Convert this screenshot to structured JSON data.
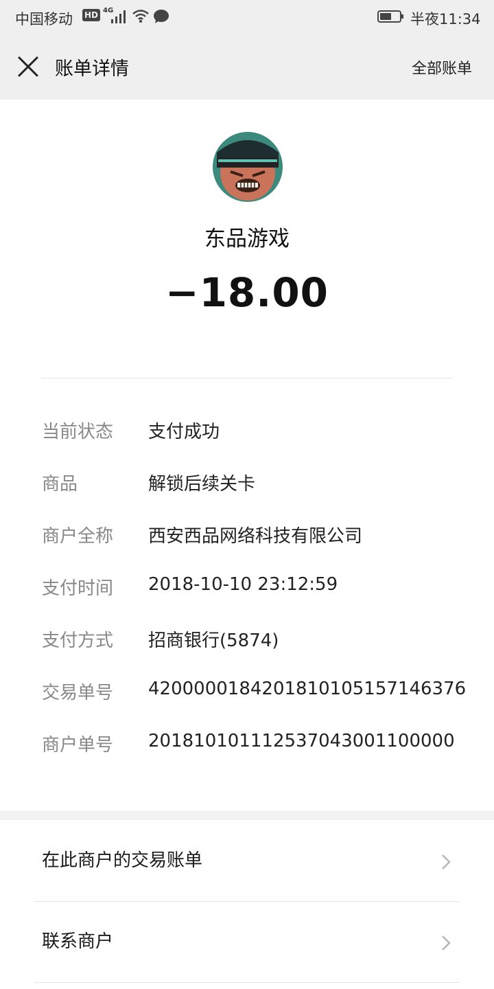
{
  "status_bar": {
    "carrier": "中国移动",
    "hd_badge": "HD",
    "network": "4G",
    "time": "半夜11:34"
  },
  "nav": {
    "title": "账单详情",
    "all_bills": "全部账单"
  },
  "merchant": {
    "name": "东品游戏",
    "amount": "−18.00"
  },
  "details": [
    {
      "label": "当前状态",
      "value": "支付成功"
    },
    {
      "label": "商品",
      "value": "解锁后续关卡"
    },
    {
      "label": "商户全称",
      "value": "西安西品网络科技有限公司"
    },
    {
      "label": "支付时间",
      "value": "2018-10-10 23:12:59"
    },
    {
      "label": "支付方式",
      "value": "招商银行(5874)"
    },
    {
      "label": "交易单号",
      "value": "4200000184201810105157146376"
    },
    {
      "label": "商户单号",
      "value": "201810101112537043001100000"
    }
  ],
  "links": [
    {
      "label": "在此商户的交易账单"
    },
    {
      "label": "联系商户"
    }
  ],
  "colors": {
    "header_bg": "#efefef",
    "label_gray": "#888888",
    "text_dark": "#1a1a1a"
  }
}
